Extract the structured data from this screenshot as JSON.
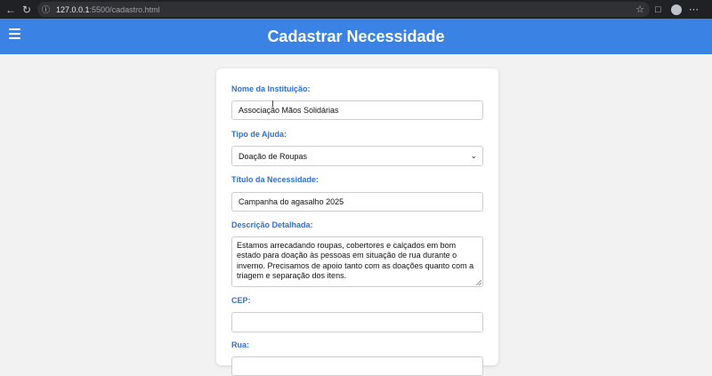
{
  "browser": {
    "url_host": "127.0.0.1",
    "url_rest": ":5500/cadastro.html"
  },
  "header": {
    "title": "Cadastrar Necessidade"
  },
  "form": {
    "instituicao": {
      "label": "Nome da Instituição:",
      "value": "Associação Mãos Solidárias"
    },
    "tipo": {
      "label": "Tipo de Ajuda:",
      "value": "Doação de Roupas"
    },
    "titulo": {
      "label": "Título da Necessidade:",
      "value": "Campanha do agasalho 2025"
    },
    "descricao": {
      "label": "Descrição Detalhada:",
      "value": "Estamos arrecadando roupas, cobertores e calçados em bom estado para doação às pessoas em situação de rua durante o inverno. Precisamos de apoio tanto com as doações quanto com a triagem e separação dos itens."
    },
    "cep": {
      "label": "CEP:",
      "value": ""
    },
    "rua": {
      "label": "Rua:",
      "value": ""
    }
  },
  "icons": {
    "back": "arrow-left-icon",
    "reload": "reload-icon",
    "info": "info-icon",
    "star": "star-icon",
    "menu": "hamburger-menu-icon"
  }
}
